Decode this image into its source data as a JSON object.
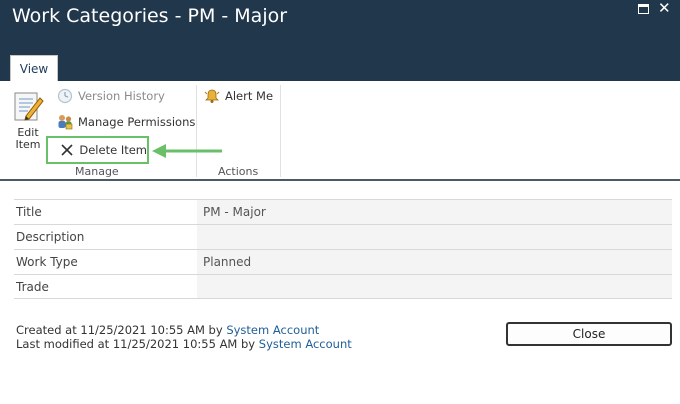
{
  "window": {
    "title": "Work Categories - PM - Major",
    "maximize_icon": "maximize-icon",
    "close_icon": "close-icon",
    "close_glyph": "✕"
  },
  "ribbon": {
    "tab_label": "View",
    "groups": {
      "manage": {
        "label": "Manage",
        "edit_item": {
          "label": "Edit\nItem",
          "icon": "edit-document-icon"
        },
        "version_history": {
          "label": "Version History",
          "icon": "version-history-icon",
          "enabled": false
        },
        "manage_permissions": {
          "label": "Manage Permissions",
          "icon": "permissions-icon"
        },
        "delete_item": {
          "label": "Delete Item",
          "icon": "delete-x-icon",
          "highlighted": true,
          "highlight_color": "#6abf69"
        }
      },
      "actions": {
        "label": "Actions",
        "alert_me": {
          "label": "Alert Me",
          "icon": "bell-icon"
        }
      }
    },
    "annotation": {
      "type": "arrow",
      "color": "#6abf69",
      "points_to": "Delete Item"
    }
  },
  "details": {
    "rows": [
      {
        "label": "Title",
        "value": "PM - Major"
      },
      {
        "label": "Description",
        "value": ""
      },
      {
        "label": "Work Type",
        "value": "Planned"
      },
      {
        "label": "Trade",
        "value": ""
      }
    ]
  },
  "footer": {
    "created_prefix": "Created at 11/25/2021 10:55 AM by ",
    "created_by": "System Account",
    "modified_prefix": "Last modified at 11/25/2021 10:55 AM by ",
    "modified_by": "System Account",
    "close_button": "Close"
  },
  "colors": {
    "header_bg": "#21374c",
    "link": "#1f5e98",
    "highlight": "#6abf69"
  }
}
